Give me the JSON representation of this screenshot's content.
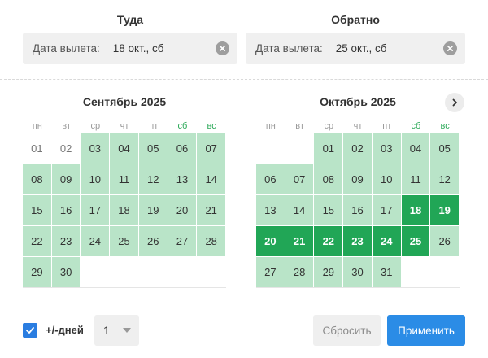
{
  "outbound": {
    "header": "Туда",
    "field_label": "Дата вылета:",
    "field_value": "18 окт., сб"
  },
  "return": {
    "header": "Обратно",
    "field_label": "Дата вылета:",
    "field_value": "25 окт., сб"
  },
  "weekdays": [
    "пн",
    "вт",
    "ср",
    "чт",
    "пт",
    "сб",
    "вс"
  ],
  "months": [
    {
      "title": "Сентябрь 2025",
      "weeks": [
        [
          {
            "d": "01",
            "s": "past"
          },
          {
            "d": "02",
            "s": "past"
          },
          {
            "d": "03",
            "s": "avail"
          },
          {
            "d": "04",
            "s": "avail"
          },
          {
            "d": "05",
            "s": "avail"
          },
          {
            "d": "06",
            "s": "avail"
          },
          {
            "d": "07",
            "s": "avail"
          }
        ],
        [
          {
            "d": "08",
            "s": "avail"
          },
          {
            "d": "09",
            "s": "avail"
          },
          {
            "d": "10",
            "s": "avail"
          },
          {
            "d": "11",
            "s": "avail"
          },
          {
            "d": "12",
            "s": "avail"
          },
          {
            "d": "13",
            "s": "avail"
          },
          {
            "d": "14",
            "s": "avail"
          }
        ],
        [
          {
            "d": "15",
            "s": "avail"
          },
          {
            "d": "16",
            "s": "avail"
          },
          {
            "d": "17",
            "s": "avail"
          },
          {
            "d": "18",
            "s": "avail"
          },
          {
            "d": "19",
            "s": "avail"
          },
          {
            "d": "20",
            "s": "avail"
          },
          {
            "d": "21",
            "s": "avail"
          }
        ],
        [
          {
            "d": "22",
            "s": "avail"
          },
          {
            "d": "23",
            "s": "avail"
          },
          {
            "d": "24",
            "s": "avail"
          },
          {
            "d": "25",
            "s": "avail"
          },
          {
            "d": "26",
            "s": "avail"
          },
          {
            "d": "27",
            "s": "avail"
          },
          {
            "d": "28",
            "s": "avail"
          }
        ],
        [
          {
            "d": "29",
            "s": "avail"
          },
          {
            "d": "30",
            "s": "avail"
          },
          {
            "d": "",
            "s": "empty"
          },
          {
            "d": "",
            "s": "empty"
          },
          {
            "d": "",
            "s": "empty"
          },
          {
            "d": "",
            "s": "empty"
          },
          {
            "d": "",
            "s": "empty"
          }
        ]
      ]
    },
    {
      "title": "Октябрь 2025",
      "weeks": [
        [
          {
            "d": "",
            "s": "empty"
          },
          {
            "d": "",
            "s": "empty"
          },
          {
            "d": "01",
            "s": "avail"
          },
          {
            "d": "02",
            "s": "avail"
          },
          {
            "d": "03",
            "s": "avail"
          },
          {
            "d": "04",
            "s": "avail"
          },
          {
            "d": "05",
            "s": "avail"
          }
        ],
        [
          {
            "d": "06",
            "s": "avail"
          },
          {
            "d": "07",
            "s": "avail"
          },
          {
            "d": "08",
            "s": "avail"
          },
          {
            "d": "09",
            "s": "avail"
          },
          {
            "d": "10",
            "s": "avail"
          },
          {
            "d": "11",
            "s": "avail"
          },
          {
            "d": "12",
            "s": "avail"
          }
        ],
        [
          {
            "d": "13",
            "s": "avail"
          },
          {
            "d": "14",
            "s": "avail"
          },
          {
            "d": "15",
            "s": "avail"
          },
          {
            "d": "16",
            "s": "avail"
          },
          {
            "d": "17",
            "s": "avail"
          },
          {
            "d": "18",
            "s": "sel"
          },
          {
            "d": "19",
            "s": "sel"
          }
        ],
        [
          {
            "d": "20",
            "s": "sel"
          },
          {
            "d": "21",
            "s": "sel"
          },
          {
            "d": "22",
            "s": "sel"
          },
          {
            "d": "23",
            "s": "sel"
          },
          {
            "d": "24",
            "s": "sel"
          },
          {
            "d": "25",
            "s": "sel"
          },
          {
            "d": "26",
            "s": "avail"
          }
        ],
        [
          {
            "d": "27",
            "s": "avail"
          },
          {
            "d": "28",
            "s": "avail"
          },
          {
            "d": "29",
            "s": "avail"
          },
          {
            "d": "30",
            "s": "avail"
          },
          {
            "d": "31",
            "s": "avail"
          },
          {
            "d": "",
            "s": "empty"
          },
          {
            "d": "",
            "s": "empty"
          }
        ]
      ]
    }
  ],
  "footer": {
    "flex_label": "+/-дней",
    "flex_checked": true,
    "flex_days": "1",
    "reset_label": "Сбросить",
    "apply_label": "Применить"
  },
  "colors": {
    "available": "#b9e4c8",
    "selected": "#21a656",
    "weekend_header": "#2eaa5a",
    "primary": "#2b8ce6",
    "checkbox": "#2a7de1"
  },
  "icons": {
    "clear": "close-circle-icon",
    "next": "chevron-right-icon",
    "check": "checkmark-icon",
    "dropdown": "caret-down-icon"
  }
}
